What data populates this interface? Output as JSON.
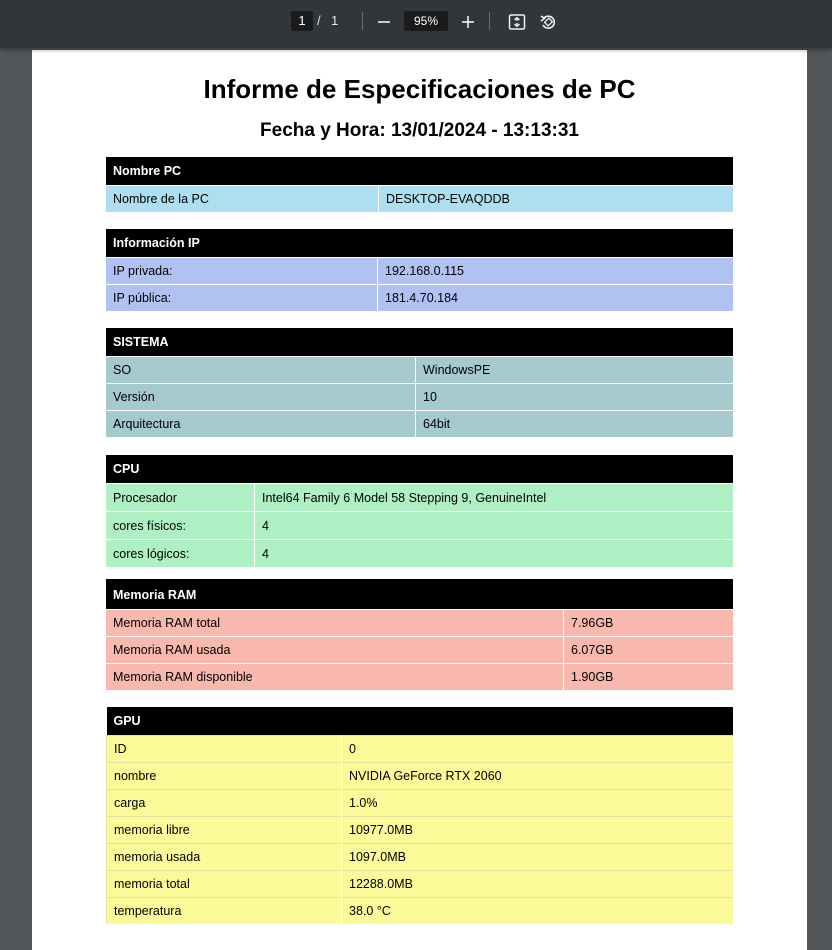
{
  "viewer": {
    "current_page": "1",
    "separator": "/",
    "total_pages": "1",
    "zoom": "95%"
  },
  "report": {
    "title": "Informe de Especificaciones de PC",
    "datetime": "Fecha y Hora: 13/01/2024 - 13:13:31"
  },
  "sections": {
    "nombre_pc": {
      "header": "Nombre PC",
      "rows": [
        [
          "Nombre de la PC",
          "DESKTOP-EVAQDDB"
        ]
      ]
    },
    "ip": {
      "header": "Información IP",
      "rows": [
        [
          "IP privada:",
          "192.168.0.115"
        ],
        [
          "IP pública:",
          "181.4.70.184"
        ]
      ]
    },
    "sistema": {
      "header": "SISTEMA",
      "rows": [
        [
          "SO",
          "WindowsPE"
        ],
        [
          "Versión",
          "10"
        ],
        [
          "Arquitectura",
          "64bit"
        ]
      ]
    },
    "cpu": {
      "header": "CPU",
      "rows": [
        [
          "Procesador",
          "Intel64 Family 6 Model 58 Stepping 9, GenuineIntel"
        ],
        [
          "cores físicos:",
          "4"
        ],
        [
          "cores lógicos:",
          "4"
        ]
      ]
    },
    "ram": {
      "header": "Memoria RAM",
      "rows": [
        [
          "Memoria RAM total",
          "7.96GB"
        ],
        [
          "Memoria RAM usada",
          "6.07GB"
        ],
        [
          "Memoria RAM disponible",
          "1.90GB"
        ]
      ]
    },
    "gpu": {
      "header": "GPU",
      "rows": [
        [
          "ID",
          "0"
        ],
        [
          "nombre",
          "NVIDIA GeForce RTX 2060"
        ],
        [
          "carga",
          "1.0%"
        ],
        [
          "memoria libre",
          "10977.0MB"
        ],
        [
          "memoria usada",
          "1097.0MB"
        ],
        [
          "memoria total",
          "12288.0MB"
        ],
        [
          "temperatura",
          "38.0 °C"
        ]
      ]
    }
  }
}
